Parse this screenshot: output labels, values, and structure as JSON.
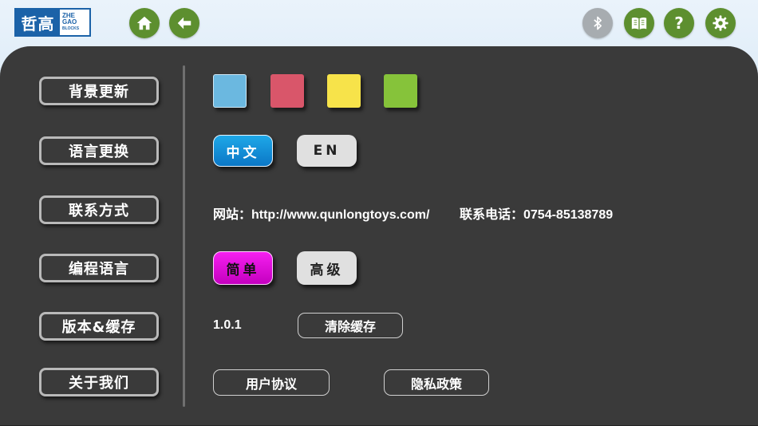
{
  "logo": {
    "zh": "哲高",
    "en_line1": "ZHE",
    "en_line2": "GAO",
    "en_line3": "BLOCKS"
  },
  "topbar": {
    "home_icon": "home-icon",
    "back_icon": "back-arrow-icon",
    "bluetooth_icon": "bluetooth-icon",
    "book_icon": "book-icon",
    "help_label": "?",
    "settings_icon": "gear-icon"
  },
  "menu": [
    {
      "label": "背景更新"
    },
    {
      "label": "语言更换"
    },
    {
      "label": "联系方式"
    },
    {
      "label": "编程语言"
    },
    {
      "label": "版本&缓存"
    },
    {
      "label": "关于我们"
    }
  ],
  "background_colors": [
    "#6bb8e0",
    "#d9566a",
    "#f7e34a",
    "#86c33a"
  ],
  "language": {
    "zh_label": "中文",
    "en_label": "EN",
    "selected": "中文"
  },
  "contact": {
    "website": "网站：http://www.qunlongtoys.com/",
    "phone": "联系电话：0754-85138789"
  },
  "programming": {
    "simple_label": "简单",
    "advanced_label": "高级",
    "selected": "简单"
  },
  "version": {
    "number": "1.0.1",
    "clear_cache_label": "清除缓存"
  },
  "about": {
    "user_agreement_label": "用户协议",
    "privacy_policy_label": "隐私政策"
  },
  "colors": {
    "panel": "#3a3a3a",
    "accent_green": "#5d8f2f",
    "selected_blue": "#0b77c6",
    "selected_magenta": "#f61ff0"
  }
}
